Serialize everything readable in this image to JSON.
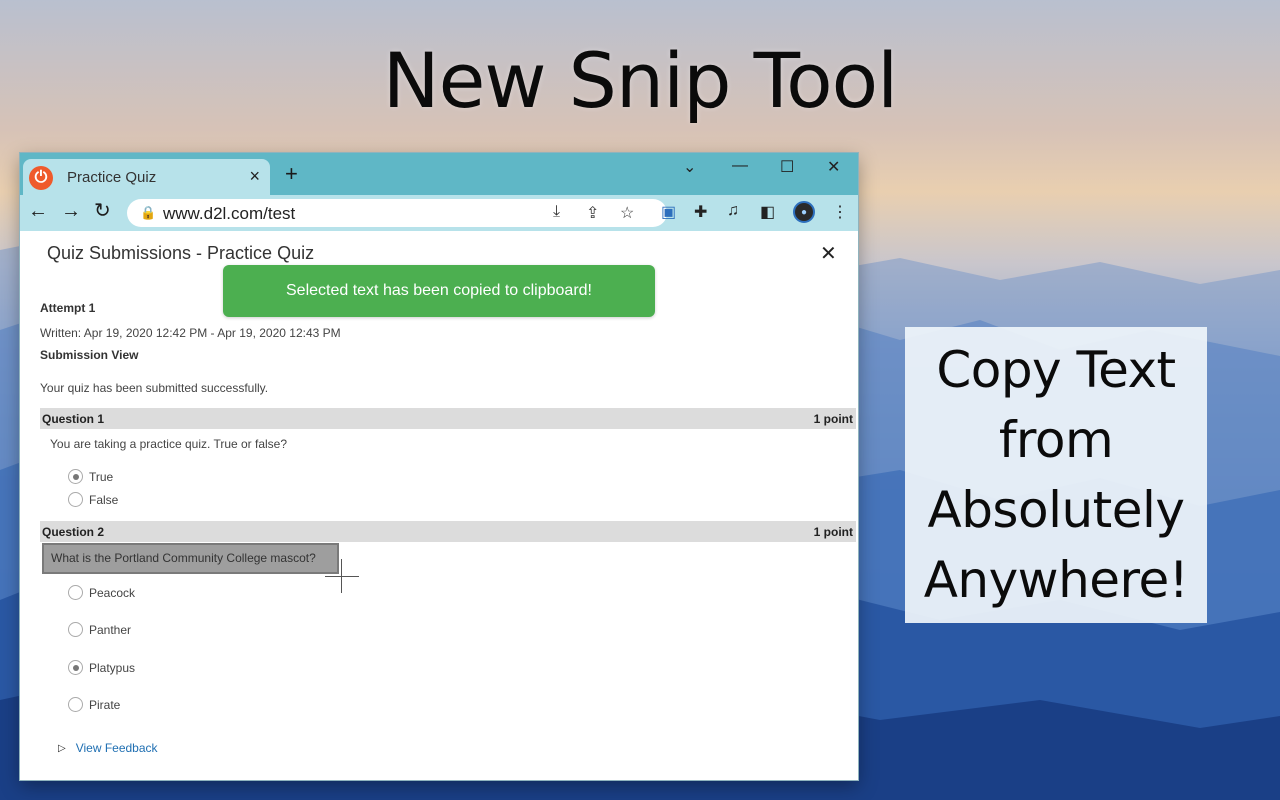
{
  "headline": "New Snip Tool",
  "promo": {
    "lines": [
      "Copy Text",
      "from",
      "Absolutely",
      "Anywhere!"
    ]
  },
  "browser": {
    "tab": {
      "title": "Practice Quiz",
      "close_icon": "×"
    },
    "new_tab_icon": "+",
    "window_controls": {
      "dropdown": "⌄",
      "minimize": "—",
      "maximize": "☐",
      "close": "✕"
    },
    "nav": {
      "back": "←",
      "forward": "→",
      "reload": "↻"
    },
    "url": "www.d2l.com/test",
    "icons": [
      "download-icon",
      "share-icon",
      "star-icon",
      "translate-extension-icon",
      "puzzle-icon",
      "media-icon",
      "sidepanel-icon",
      "profile-icon",
      "menu-icon"
    ]
  },
  "page": {
    "dialog_title": "Quiz Submissions - Practice Quiz",
    "close_icon": "✕",
    "toast": "Selected text has been copied to clipboard!",
    "attempt": "Attempt 1",
    "written": "Written: Apr 19, 2020 12:42 PM - Apr 19, 2020 12:43 PM",
    "submission_view": "Submission View",
    "submitted_msg": "Your quiz has been submitted successfully.",
    "questions": [
      {
        "label": "Question 1",
        "points": "1 point",
        "text": "You are taking a practice quiz. True or false?",
        "options": [
          {
            "label": "True",
            "selected": true
          },
          {
            "label": "False",
            "selected": false
          }
        ]
      },
      {
        "label": "Question 2",
        "points": "1 point",
        "text": "What is the Portland Community College mascot?",
        "options": [
          {
            "label": "Peacock",
            "selected": false
          },
          {
            "label": "Panther",
            "selected": false
          },
          {
            "label": "Platypus",
            "selected": true
          },
          {
            "label": "Pirate",
            "selected": false
          }
        ]
      }
    ],
    "view_feedback": "View Feedback"
  }
}
